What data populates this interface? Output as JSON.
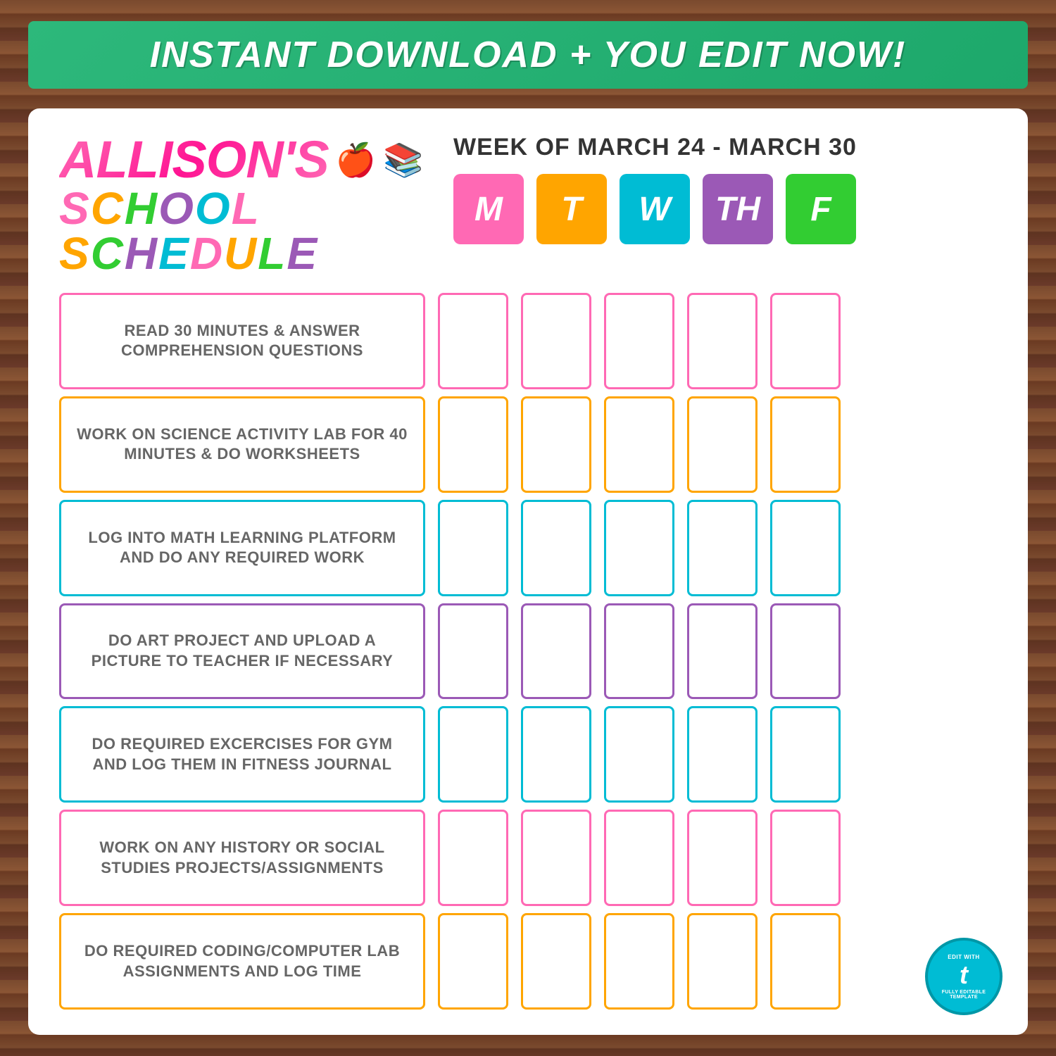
{
  "banner": {
    "text": "INSTANT DOWNLOAD + YOU EDIT NOW!"
  },
  "header": {
    "name": "ALLISON'S",
    "school_schedule": "SCHOOL SCHEDULE",
    "week_text": "WEEK OF MARCH 24 - MARCH 30"
  },
  "days": [
    {
      "label": "M",
      "color_class": "day-m"
    },
    {
      "label": "T",
      "color_class": "day-t"
    },
    {
      "label": "W",
      "color_class": "day-w"
    },
    {
      "label": "TH",
      "color_class": "day-th"
    },
    {
      "label": "F",
      "color_class": "day-f"
    }
  ],
  "tasks": [
    {
      "id": 1,
      "text": "READ 30 MINUTES & ANSWER COMPREHENSION QUESTIONS",
      "row_class": "row-1"
    },
    {
      "id": 2,
      "text": "WORK ON SCIENCE ACTIVITY LAB FOR 40 MINUTES & DO WORKSHEETS",
      "row_class": "row-2"
    },
    {
      "id": 3,
      "text": "LOG INTO MATH LEARNING PLATFORM AND DO ANY REQUIRED WORK",
      "row_class": "row-3"
    },
    {
      "id": 4,
      "text": "DO ART PROJECT AND UPLOAD A PICTURE TO TEACHER IF NECESSARY",
      "row_class": "row-4"
    },
    {
      "id": 5,
      "text": "DO REQUIRED EXCERCISES FOR GYM AND LOG THEM IN FITNESS JOURNAL",
      "row_class": "row-5"
    },
    {
      "id": 6,
      "text": "WORK ON ANY HISTORY OR SOCIAL STUDIES PROJECTS/ASSIGNMENTS",
      "row_class": "row-6"
    },
    {
      "id": 7,
      "text": "DO REQUIRED CODING/COMPUTER LAB ASSIGNMENTS AND LOG TIME",
      "row_class": "row-7"
    }
  ],
  "badge": {
    "top_text": "EDIT WITH",
    "letter": "t",
    "bottom_text": "FULLY EDITABLE TEMPLATE"
  }
}
